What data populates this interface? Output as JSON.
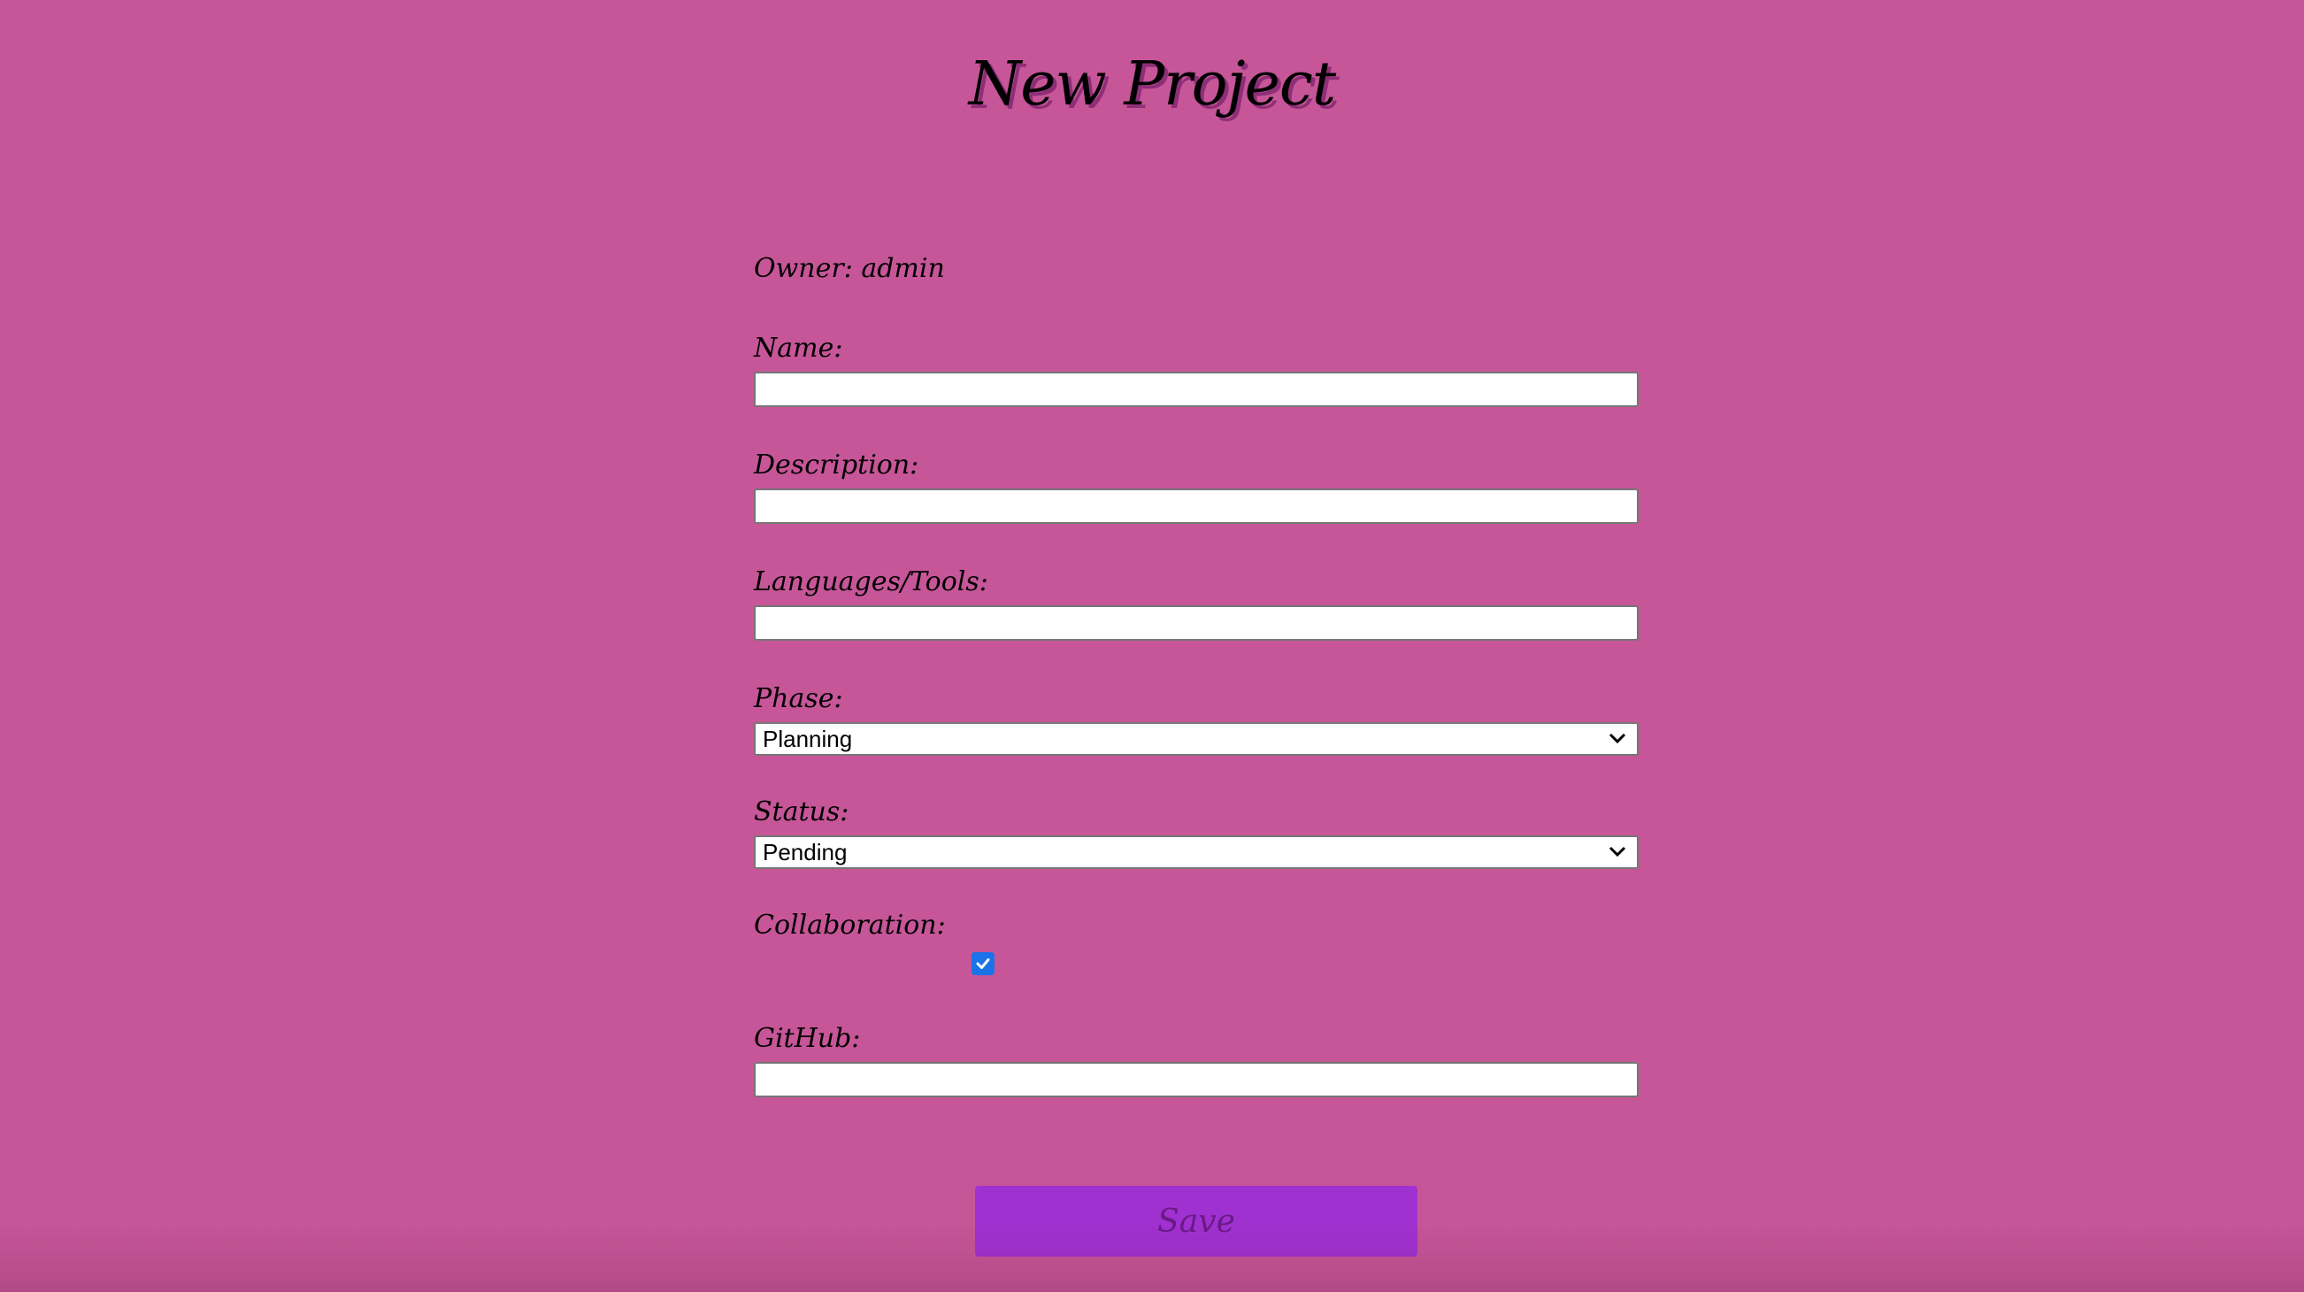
{
  "page": {
    "title": "New Project",
    "background_color": "#c65698",
    "accent_color": "#a031d1"
  },
  "form": {
    "owner_label": "Owner:",
    "owner_value": "admin",
    "name": {
      "label": "Name:",
      "value": ""
    },
    "description": {
      "label": "Description:",
      "value": ""
    },
    "languages_tools": {
      "label": "Languages/Tools:",
      "value": ""
    },
    "phase": {
      "label": "Phase:",
      "selected": "Planning",
      "icon": "chevron-down-icon"
    },
    "status": {
      "label": "Status:",
      "selected": "Pending",
      "icon": "chevron-down-icon"
    },
    "collaboration": {
      "label": "Collaboration:",
      "checked": true,
      "checkbox_color": "#1a73e8"
    },
    "github": {
      "label": "GitHub:",
      "value": ""
    },
    "save_label": "Save"
  }
}
